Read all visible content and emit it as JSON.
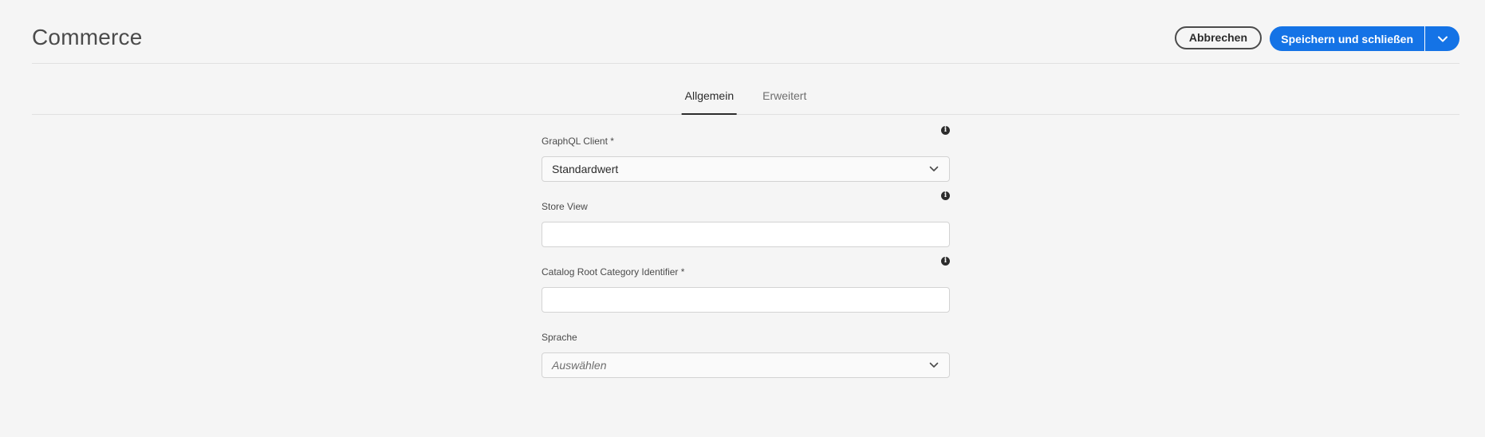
{
  "header": {
    "title": "Commerce",
    "cancel_label": "Abbrechen",
    "save_label": "Speichern und schließen"
  },
  "tabs": [
    {
      "label": "Allgemein",
      "active": true
    },
    {
      "label": "Erweitert",
      "active": false
    }
  ],
  "form": {
    "graphql_client": {
      "label": "GraphQL Client *",
      "value": "Standardwert"
    },
    "store_view": {
      "label": "Store View",
      "value": "",
      "placeholder": ""
    },
    "catalog_root": {
      "label": "Catalog Root Category Identifier *",
      "value": "",
      "placeholder": ""
    },
    "language": {
      "label": "Sprache",
      "placeholder": "Auswählen"
    }
  },
  "colors": {
    "accent": "#1473e6",
    "background": "#f5f5f5"
  },
  "icons": {
    "info": "info-icon",
    "chevron": "chevron-down-icon"
  }
}
